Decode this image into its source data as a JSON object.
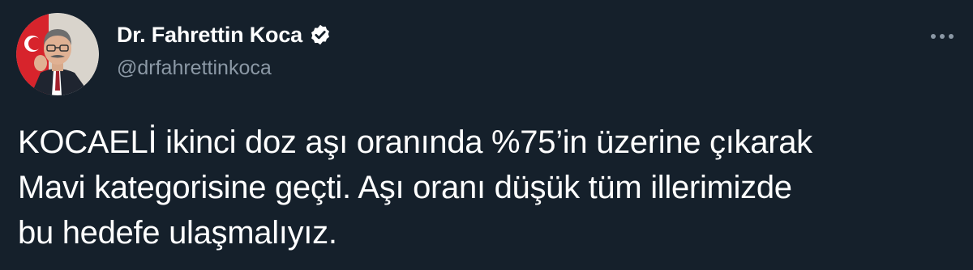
{
  "author": {
    "display_name": "Dr. Fahrettin Koca",
    "handle": "@drfahrettinkoca",
    "avatar_icon": "profile-photo",
    "verified_icon": "verified-badge-icon"
  },
  "menu": {
    "icon": "more-options-icon"
  },
  "tweet": {
    "lines": [
      "KOCAELİ ikinci doz aşı oranında %75’in üzerine çıkarak",
      "Mavi kategorisine geçti. Aşı oranı düşük tüm illerimizde",
      "bu hedefe ulaşmalıyız."
    ]
  },
  "colors": {
    "background": "#15202b",
    "text": "#ffffff",
    "secondary_text": "#8b98a5"
  }
}
